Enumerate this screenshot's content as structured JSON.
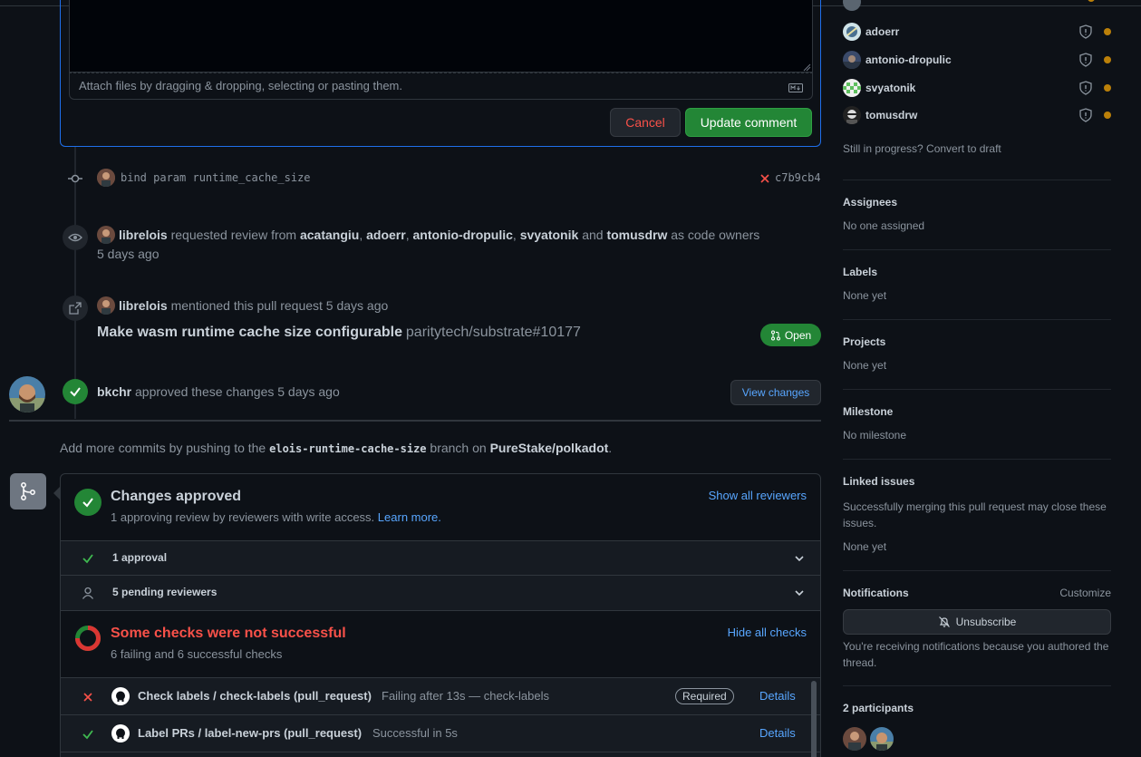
{
  "editor": {
    "attach_hint": "Attach files by dragging & dropping, selecting or pasting them.",
    "cancel_label": "Cancel",
    "update_label": "Update comment"
  },
  "commit": {
    "message": "bind param runtime_cache_size",
    "sha": "c7b9cb4"
  },
  "review_request": {
    "author": "librelois",
    "text1": "requested review from",
    "reviewers": [
      "acatangiu",
      "adoerr",
      "antonio-dropulic",
      "svyatonik"
    ],
    "and_text": "and",
    "last_reviewer": "tomusdrw",
    "suffix": "as code owners",
    "time": "5 days ago"
  },
  "mention": {
    "author": "librelois",
    "text": "mentioned this pull request 5 days ago",
    "pr_title": "Make wasm runtime cache size configurable",
    "pr_ref": "paritytech/substrate#10177",
    "state": "Open"
  },
  "approval": {
    "author": "bkchr",
    "text": "approved these changes 5 days ago",
    "view_changes": "View changes"
  },
  "push_hint": {
    "prefix": "Add more commits by pushing to the",
    "branch": "elois-runtime-cache-size",
    "middle": "branch on",
    "repo": "PureStake/polkadot",
    "suffix": "."
  },
  "merge_box": {
    "approved_title": "Changes approved",
    "approved_sub": "1 approving review by reviewers with write access.",
    "learn_more": "Learn more.",
    "show_reviewers": "Show all reviewers",
    "approvals": "1 approval",
    "pending": "5 pending reviewers",
    "checks_title": "Some checks were not successful",
    "checks_sub": "6 failing and 6 successful checks",
    "hide_checks": "Hide all checks",
    "checks": [
      {
        "name": "Check labels / check-labels (pull_request)",
        "status": "Failing after 13s — check-labels",
        "required": "Required",
        "details": "Details"
      },
      {
        "name": "Label PRs / label-new-prs (pull_request)",
        "status": "Successful in 5s",
        "details": "Details"
      }
    ]
  },
  "sidebar": {
    "reviewers": [
      "adoerr",
      "antonio-dropulic",
      "svyatonik",
      "tomusdrw"
    ],
    "draft_hint": "Still in progress? Convert to draft",
    "assignees_title": "Assignees",
    "assignees_val": "No one assigned",
    "labels_title": "Labels",
    "labels_val": "None yet",
    "projects_title": "Projects",
    "projects_val": "None yet",
    "milestone_title": "Milestone",
    "milestone_val": "No milestone",
    "linked_title": "Linked issues",
    "linked_desc": "Successfully merging this pull request may close these issues.",
    "linked_val": "None yet",
    "notif_title": "Notifications",
    "customize": "Customize",
    "unsubscribe": "Unsubscribe",
    "notif_reason": "You're receiving notifications because you authored the thread.",
    "participants": "2 participants"
  },
  "colors": {
    "green": "#238636",
    "red": "#f85149",
    "link": "#58a6ff",
    "pending": "#bb8009"
  }
}
